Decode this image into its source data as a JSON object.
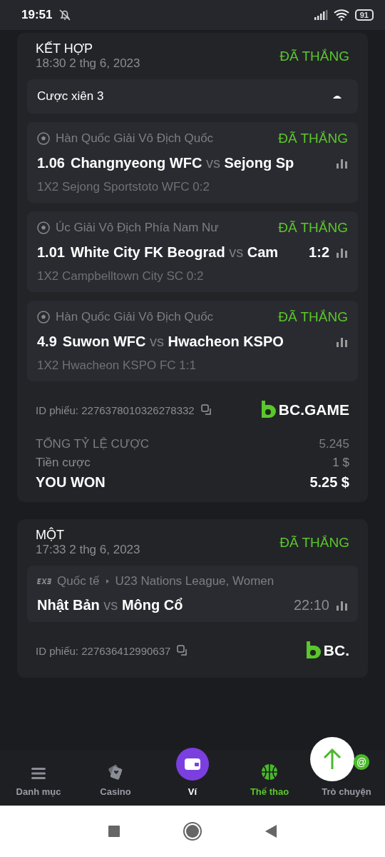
{
  "status_bar": {
    "time": "19:51",
    "battery": "91"
  },
  "bets": [
    {
      "title": "KẾT HỢP",
      "date": "18:30 2 thg 6, 2023",
      "status": "ĐÃ THẮNG",
      "dropdown": {
        "label": "Cược xiên 3",
        "expanded": true
      },
      "legs": [
        {
          "kind": "soccer",
          "league": "Hàn Quốc Giải Vô Địch Quốc",
          "status": "ĐÃ THẮNG",
          "odds": "1.06",
          "home": "Changnyeong WFC",
          "vs": "vs",
          "away": "Sejong Sp",
          "pick": "1X2 Sejong Sportstoto WFC  0:2"
        },
        {
          "kind": "soccer",
          "league": "Úc Giải Vô Địch Phía Nam Nư",
          "status": "ĐÃ THẮNG",
          "odds": "1.01",
          "home": "White City FK Beograd",
          "vs": "vs",
          "away": "Cam",
          "score": "1:2",
          "pick": "1X2 Campbelltown City SC  0:2"
        },
        {
          "kind": "soccer",
          "league": "Hàn Quốc Giải Vô Địch Quốc",
          "status": "ĐÃ THẮNG",
          "odds": "4.9",
          "home": "Suwon WFC",
          "vs": "vs",
          "away": "Hwacheon KSPO",
          "pick": "1X2 Hwacheon KSPO FC  1:1"
        }
      ],
      "ticket": "ID phiếu: 2276378010326278332",
      "logo": "BC.GAME",
      "summary": [
        {
          "kind": "caps",
          "label": "TỔNG TỶ LỆ CƯỢC",
          "value": "5.245"
        },
        {
          "kind": "plain",
          "label": "Tiền cược",
          "value": "1 $"
        },
        {
          "kind": "total",
          "label": "YOU WON",
          "value": "5.25 $"
        }
      ]
    },
    {
      "title": "MỘT",
      "date": "17:33 2 thg 6, 2023",
      "status": "ĐÃ THẮNG",
      "legs": [
        {
          "kind": "basketball",
          "league": "Quốc tế",
          "sub_league": "U23 Nations League, Women",
          "home": "Nhật Bản",
          "vs": "vs",
          "away": "Mông Cổ",
          "score": "22:10"
        }
      ],
      "ticket": "ID phiếu: 227636412990637",
      "logo": "BC."
    }
  ],
  "nav": [
    {
      "kind": "menu",
      "label": "Danh mục",
      "selected": false
    },
    {
      "kind": "casino",
      "label": "Casino",
      "selected": false
    },
    {
      "kind": "wallet",
      "label": "Ví",
      "selected": false
    },
    {
      "kind": "sports",
      "label": "Thể thao",
      "selected": true
    },
    {
      "kind": "chat",
      "label": "Trò chuyện",
      "selected": false
    }
  ],
  "chat_badge": "@"
}
